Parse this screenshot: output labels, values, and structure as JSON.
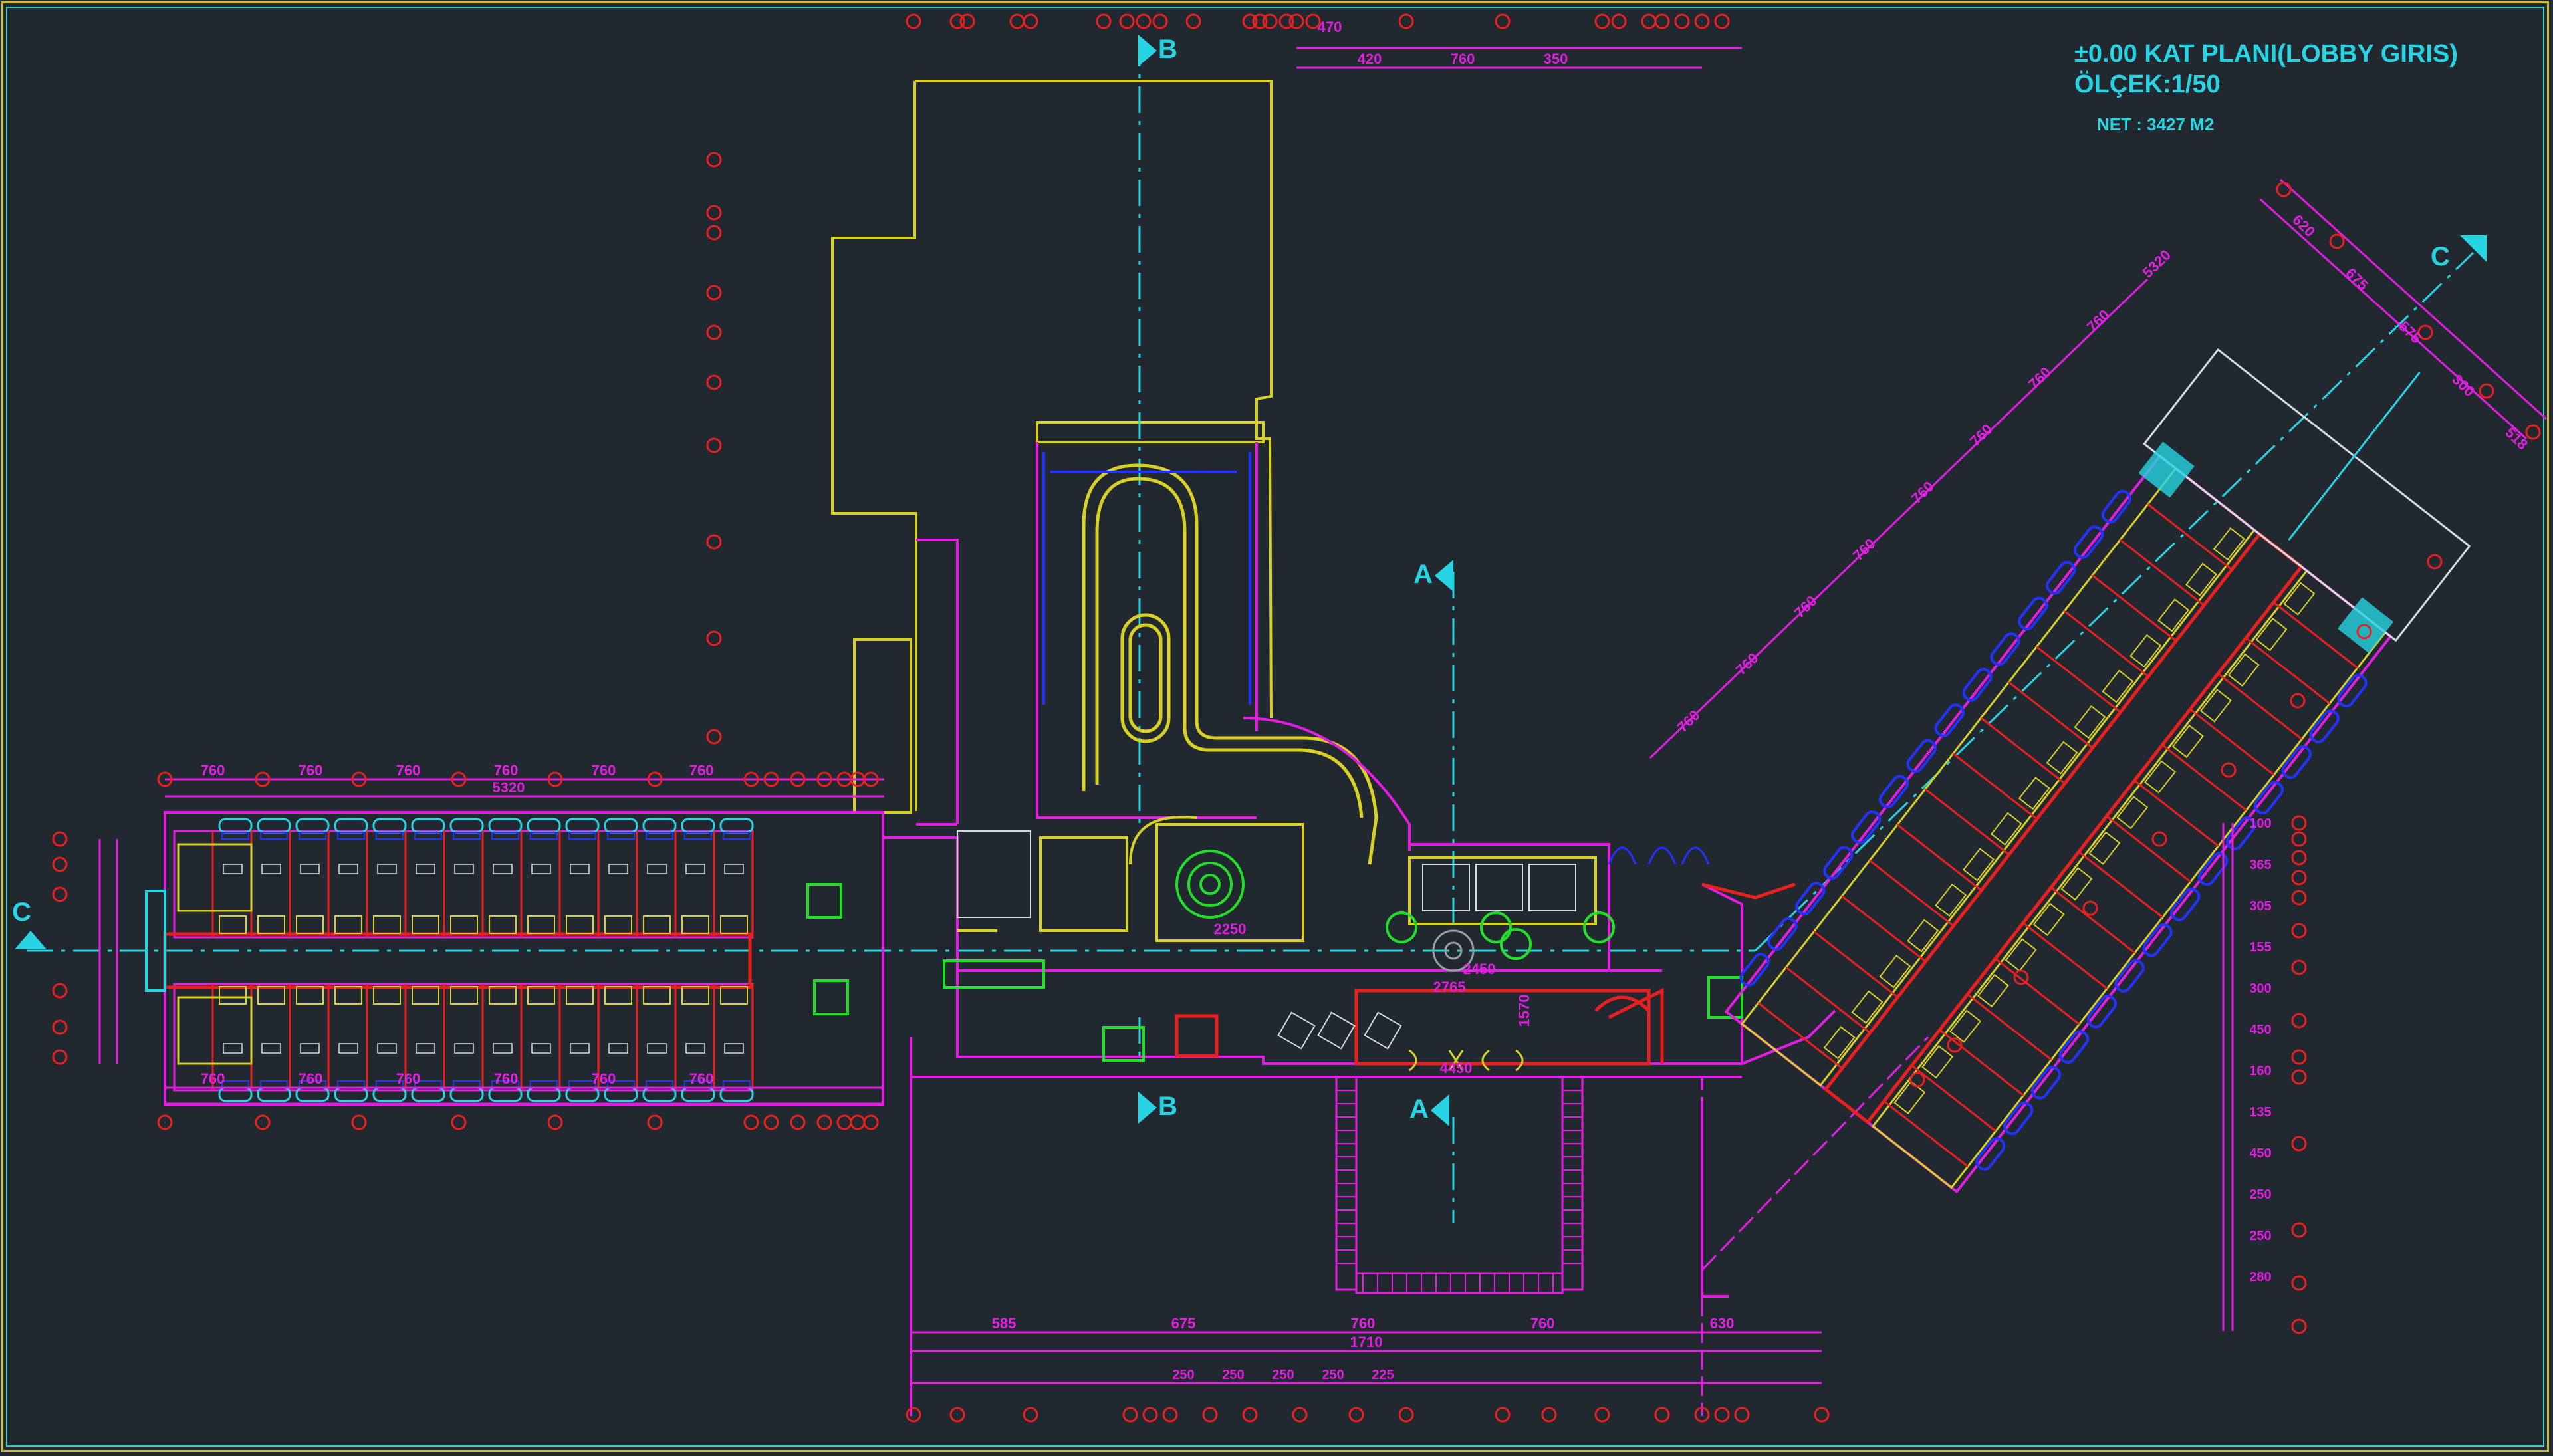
{
  "title": {
    "line1": "±0.00 KAT PLANI(LOBBY GIRIS)",
    "line2": "ÖLÇEK:1/50",
    "net": "NET : 3427 M2"
  },
  "section_markers": {
    "a_top": "A",
    "a_bottom": "A",
    "b_top": "B",
    "b_bottom": "B",
    "c_left": "C",
    "c_right": "C"
  },
  "dims": {
    "west_top": [
      "760",
      "760",
      "760",
      "760",
      "760",
      "760"
    ],
    "west_total": "5320",
    "west_bottom": [
      "760",
      "760",
      "760",
      "760",
      "760",
      "760"
    ],
    "north": [
      "420",
      "760",
      "350"
    ],
    "north_left": "470",
    "south": [
      "585",
      "675",
      "760",
      "760",
      "630"
    ],
    "south_inner": [
      "250",
      "250",
      "250",
      "250",
      "225"
    ],
    "south_mid": "1710",
    "center": [
      "2765",
      "2450",
      "4450",
      "1570",
      "2250"
    ],
    "diag": [
      "760",
      "760",
      "760",
      "760",
      "760",
      "760",
      "760",
      "760",
      "5320"
    ],
    "ne": [
      "620",
      "675",
      "575",
      "300",
      "518"
    ],
    "right_scale": [
      "100",
      "365",
      "305",
      "155",
      "300",
      "450",
      "160",
      "135",
      "450",
      "250",
      "250",
      "280"
    ]
  },
  "colors": {
    "background": "#212830",
    "magenta": "#e21ee0",
    "yellow": "#d8d024",
    "red": "#e82020",
    "cyan": "#27d4e4",
    "green": "#22e02a",
    "blue": "#2232ff",
    "white": "#d8dce0",
    "grey": "#9aa0a6"
  }
}
